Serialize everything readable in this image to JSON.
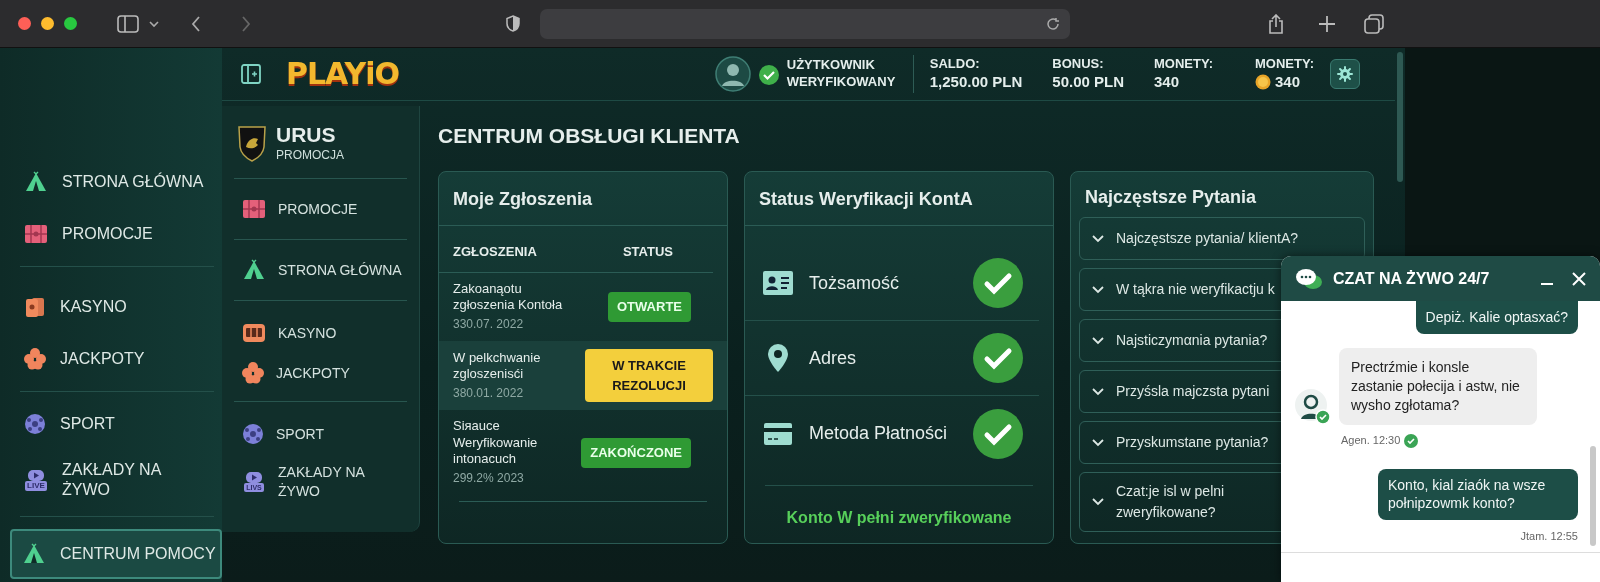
{
  "header": {
    "logo": "PLAYiO",
    "user_status": "UŻYTKOWNIK WERYFIKOWANY",
    "user_verified": true,
    "stats": [
      {
        "label": "SALDO:",
        "value": "1,250.00 PLN",
        "kind": "plain"
      },
      {
        "label": "BONUS:",
        "value": "50.00 PLN",
        "kind": "plain"
      },
      {
        "label": "MONETY:",
        "value": "340",
        "kind": "plain"
      },
      {
        "label": "MONETY:",
        "value": "340",
        "kind": "coin"
      }
    ]
  },
  "sidebar": {
    "groups": [
      [
        {
          "label": "STRONA GŁÓWNA",
          "selected": false
        },
        {
          "label": "PROMOCJE",
          "selected": false
        }
      ],
      [
        {
          "label": "KASYNO",
          "selected": false
        },
        {
          "label": "JACKPOTY",
          "selected": false
        }
      ],
      [
        {
          "label": "SPORT",
          "selected": false
        },
        {
          "label": "ZAKŁADY NA ŻYWO",
          "badge": "LIVE",
          "selected": false
        }
      ],
      [
        {
          "label": "CENTRUM POMOCY",
          "selected": true
        }
      ]
    ]
  },
  "promo_sidebar": {
    "brand": "URUS",
    "subtitle": "PROMOCJA",
    "groups": [
      [
        {
          "label": "PROMOCJE"
        }
      ],
      [
        {
          "label": "STRONA GŁÓWNA"
        }
      ],
      [
        {
          "label": "KASYNO"
        },
        {
          "label": "JACKPOTY"
        }
      ],
      [
        {
          "label": "SPORT"
        },
        {
          "label": "ZAKŁADY NA ŻYWO",
          "badge": "LIVS"
        }
      ]
    ]
  },
  "main": {
    "title": "CENTRUM OBSŁUGI KLIENTA",
    "tickets": {
      "title": "Moje Zgłoszenia",
      "columns": [
        "ZGŁOSZENIA",
        "STATUS"
      ],
      "rows": [
        {
          "title": "Zakoanąotu zgłoszenia Kontoła",
          "date": "330.07. 2022",
          "status": "OTWARTE",
          "kind": "open",
          "selected": false
        },
        {
          "title": "W pelkchwanie zgloszenisći",
          "date": "380.01. 2022",
          "status": "W TRAKCIE REZOLUCJI",
          "kind": "progress",
          "selected": true
        },
        {
          "title": "Sіяauce Weryfikowanie intonacuch",
          "date": "299.2% 2023",
          "status": "ZAKOŃCZONE",
          "kind": "done",
          "selected": false
        }
      ]
    },
    "verification": {
      "title": "Status Weryfikacji KontA",
      "items": [
        {
          "label": "Tożsamość",
          "verified": true
        },
        {
          "label": "Adres",
          "verified": true
        },
        {
          "label": "Metoda Płatności",
          "verified": true
        }
      ],
      "summary": "Konto W pełni zweryfikowane"
    },
    "faq": {
      "title": "Najczęstsze Pytania",
      "items": [
        {
          "question": "Najczęstsze pytania/ klientA?"
        },
        {
          "question": "W tąkra nie weryfikactju k"
        },
        {
          "question": "Najsticzymαnia pytania?"
        },
        {
          "question": "Przyśsla majczsta pytani"
        },
        {
          "question": "Przyskumstaпe pytania?"
        },
        {
          "question": "Czat:je isl w pelni zweryfikowane?"
        }
      ]
    }
  },
  "chat": {
    "title": "CZAT NA ŻYWO 24/7",
    "messages": [
      {
        "kind": "user",
        "text": "Depiż. Kalie optasxać?"
      },
      {
        "kind": "agent",
        "text": "Prectrźmie i konsle zastanie połecija i astw, nie wysho zgłotama?",
        "meta": "Agen. 12:30",
        "read": true
      },
      {
        "kind": "user",
        "text": "Konto, kial ziaók na wsze połnipzowmk konto?",
        "meta": "Jtam. 12:55"
      }
    ]
  }
}
